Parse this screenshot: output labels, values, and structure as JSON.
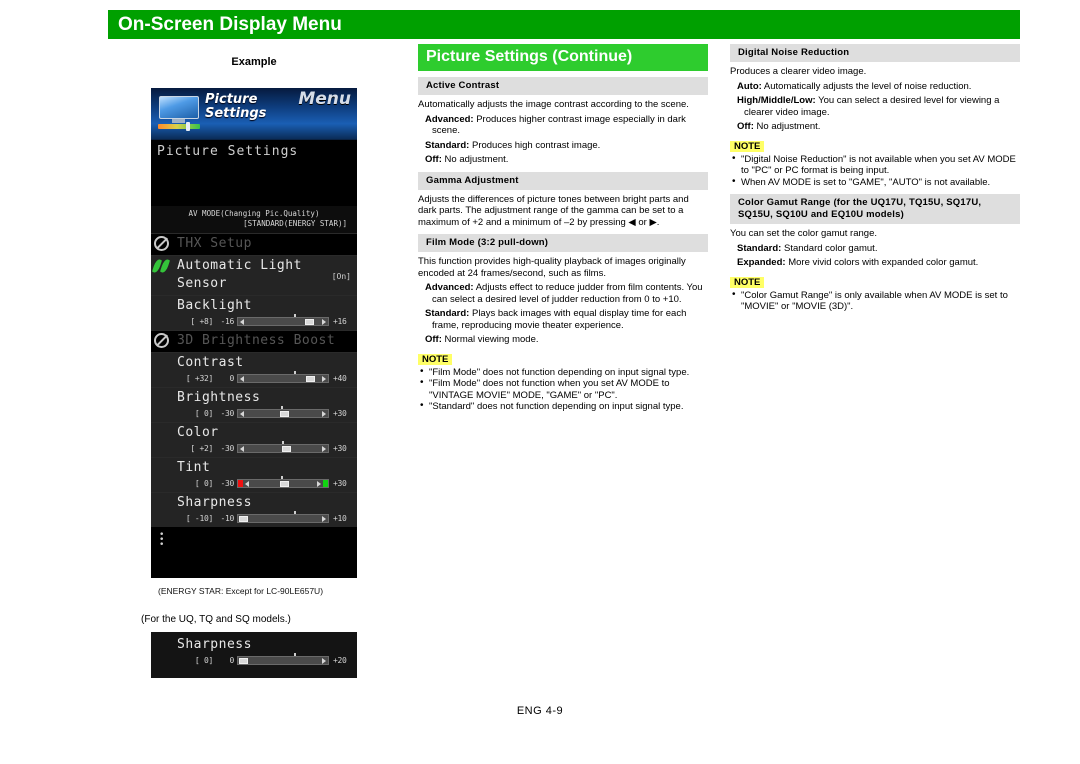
{
  "header": {
    "title": "On-Screen Display Menu"
  },
  "left": {
    "example_label": "Example",
    "tv_menu": {
      "menu_word": "Menu",
      "icon_title_line1": "Picture",
      "icon_title_line2": "Settings",
      "section_title": "Picture Settings",
      "avmode_line1": "AV MODE(Changing Pic.Quality)",
      "avmode_line2": "[STANDARD(ENERGY STAR)]",
      "rows": [
        {
          "label": "THX Setup",
          "icon": "deny-icon",
          "disabled": true,
          "right": ""
        },
        {
          "label": "Automatic Light Sensor",
          "icon": "leaf-icon",
          "disabled": false,
          "right": "[On]"
        },
        {
          "label": "Backlight",
          "icon": "",
          "disabled": false,
          "value": "[  +8]",
          "min": "-16",
          "max": "+16"
        },
        {
          "label": "3D Brightness Boost",
          "icon": "deny-icon",
          "disabled": true,
          "right": ""
        },
        {
          "label": "Contrast",
          "icon": "",
          "disabled": false,
          "value": "[ +32]",
          "min": "0",
          "max": "+40"
        },
        {
          "label": "Brightness",
          "icon": "",
          "disabled": false,
          "value": "[   0]",
          "min": "-30",
          "max": "+30"
        },
        {
          "label": "Color",
          "icon": "",
          "disabled": false,
          "value": "[  +2]",
          "min": "-30",
          "max": "+30"
        },
        {
          "label": "Tint",
          "icon": "",
          "disabled": false,
          "value": "[   0]",
          "min": "-30",
          "max": "+30"
        },
        {
          "label": "Sharpness",
          "icon": "",
          "disabled": false,
          "value": "[ -10]",
          "min": "-10",
          "max": "+10"
        }
      ]
    },
    "energy_note": "(ENERGY STAR: Except for LC-90LE657U)",
    "models_note": "(For the UQ, TQ and SQ models.)",
    "tv_menu_small": {
      "label": "Sharpness",
      "value": "[   0]",
      "min": "0",
      "max": "+20"
    }
  },
  "middle": {
    "head": "Picture Settings (Continue)",
    "sections": [
      {
        "head": "Active Contrast",
        "body": "Automatically adjusts the image contrast according to the scene.",
        "items": [
          {
            "term": "Advanced:",
            "text": " Produces higher contrast image especially in dark scene."
          },
          {
            "term": "Standard:",
            "text": " Produces high contrast image."
          },
          {
            "term": "Off:",
            "text": " No adjustment."
          }
        ]
      },
      {
        "head": "Gamma Adjustment",
        "body": "Adjusts the differences of picture tones between bright parts and dark parts. The adjustment range of the gamma can be set to a maximum of +2 and a minimum of –2 by pressing ◀ or ▶.",
        "items": []
      },
      {
        "head": "Film Mode (3:2 pull-down)",
        "body": "This function provides high-quality playback of images originally encoded at 24 frames/second, such as films.",
        "items": [
          {
            "term": "Advanced:",
            "text": " Adjusts effect to reduce judder from film contents. You can select a desired level of judder reduction from 0 to +10."
          },
          {
            "term": "Standard:",
            "text": " Plays back images with equal display time for each frame, reproducing movie theater experience."
          },
          {
            "term": "Off:",
            "text": " Normal viewing mode."
          }
        ],
        "note_tag": "NOTE",
        "notes": [
          "\"Film Mode\" does not function depending on input signal type.",
          "\"Film Mode\" does not function when you set AV MODE to \"VINTAGE MOVIE\" MODE, \"GAME\" or \"PC\".",
          "\"Standard\" does not function depending on input signal type."
        ]
      }
    ]
  },
  "right": {
    "sections": [
      {
        "head": "Digital Noise Reduction",
        "body": "Produces a clearer video image.",
        "items": [
          {
            "term": "Auto:",
            "text": " Automatically adjusts the level of noise reduction."
          },
          {
            "term": "High/Middle/Low:",
            "text": " You can select a desired level for viewing a clearer video image."
          },
          {
            "term": "Off:",
            "text": " No adjustment."
          }
        ],
        "note_tag": "NOTE",
        "notes": [
          "\"Digital Noise Reduction\" is not available when you set AV MODE to \"PC\" or PC format is being input.",
          "When AV MODE is set to \"GAME\", \"AUTO\" is not available."
        ]
      },
      {
        "head": "Color Gamut Range (for the UQ17U, TQ15U, SQ17U, SQ15U, SQ10U and EQ10U models)",
        "body": "You can set the color gamut range.",
        "items": [
          {
            "term": "Standard:",
            "text": " Standard color gamut."
          },
          {
            "term": "Expanded:",
            "text": " More vivid colors with expanded color gamut."
          }
        ],
        "note_tag": "NOTE",
        "notes": [
          "\"Color Gamut Range\" is only available when AV MODE is set to \"MOVIE\" or \"MOVIE (3D)\"."
        ]
      }
    ]
  },
  "footer": {
    "page": "ENG 4-9"
  },
  "colors": {
    "title_bar_green": "#00a000",
    "head_green": "#2ecc2e",
    "subhead_grey": "#dedede",
    "note_yellow": "#ffff66"
  }
}
